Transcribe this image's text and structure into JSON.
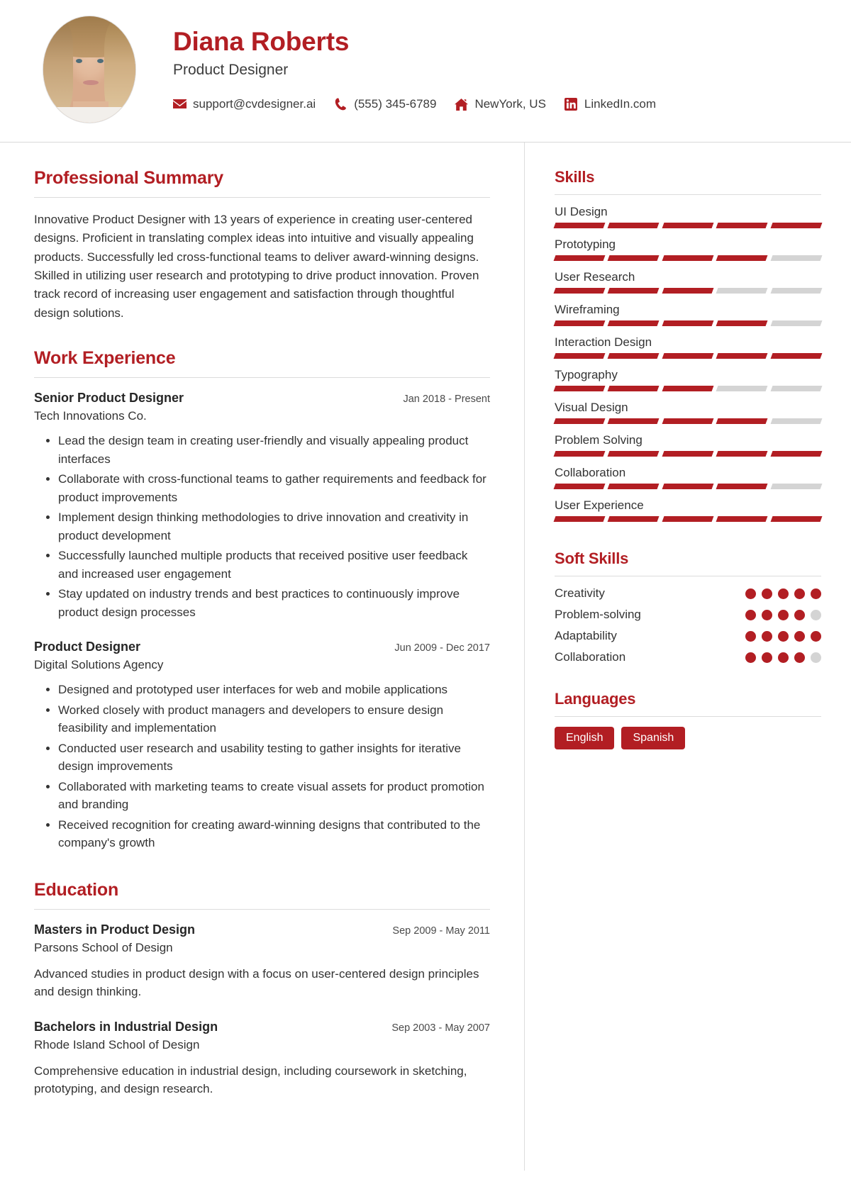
{
  "theme": {
    "accent": "#b21e23",
    "muted": "#d4d4d4",
    "text": "#333333",
    "rule": "#dcdcdc"
  },
  "header": {
    "name": "Diana Roberts",
    "job_title": "Product Designer",
    "avatar_name": "profile-photo",
    "contacts": [
      {
        "icon": "email-icon",
        "value": "support@cvdesigner.ai"
      },
      {
        "icon": "phone-icon",
        "value": "(555) 345-6789"
      },
      {
        "icon": "home-icon",
        "value": "NewYork, US"
      },
      {
        "icon": "linkedin-icon",
        "value": "LinkedIn.com"
      }
    ]
  },
  "main": {
    "summary": {
      "title": "Professional Summary",
      "text": "Innovative Product Designer with 13 years of experience in creating user-centered designs. Proficient in translating complex ideas into intuitive and visually appealing products. Successfully led cross-functional teams to deliver award-winning designs. Skilled in utilizing user research and prototyping to drive product innovation. Proven track record of increasing user engagement and satisfaction through thoughtful design solutions."
    },
    "work": {
      "title": "Work Experience",
      "jobs": [
        {
          "role": "Senior Product Designer",
          "dates": "Jan 2018 - Present",
          "company": "Tech Innovations Co.",
          "bullets": [
            "Lead the design team in creating user-friendly and visually appealing product interfaces",
            "Collaborate with cross-functional teams to gather requirements and feedback for product improvements",
            "Implement design thinking methodologies to drive innovation and creativity in product development",
            "Successfully launched multiple products that received positive user feedback and increased user engagement",
            "Stay updated on industry trends and best practices to continuously improve product design processes"
          ]
        },
        {
          "role": "Product Designer",
          "dates": "Jun 2009 - Dec 2017",
          "company": "Digital Solutions Agency",
          "bullets": [
            "Designed and prototyped user interfaces for web and mobile applications",
            "Worked closely with product managers and developers to ensure design feasibility and implementation",
            "Conducted user research and usability testing to gather insights for iterative design improvements",
            "Collaborated with marketing teams to create visual assets for product promotion and branding",
            "Received recognition for creating award-winning designs that contributed to the company's growth"
          ]
        }
      ]
    },
    "education": {
      "title": "Education",
      "entries": [
        {
          "degree": "Masters in Product Design",
          "dates": "Sep 2009 - May 2011",
          "school": "Parsons School of Design",
          "description": "Advanced studies in product design with a focus on user-centered design principles and design thinking."
        },
        {
          "degree": "Bachelors in Industrial Design",
          "dates": "Sep 2003 - May 2007",
          "school": "Rhode Island School of Design",
          "description": "Comprehensive education in industrial design, including coursework in sketching, prototyping, and design research."
        }
      ]
    }
  },
  "sidebar": {
    "skills": {
      "title": "Skills",
      "max": 5,
      "items": [
        {
          "label": "UI Design",
          "level": 5
        },
        {
          "label": "Prototyping",
          "level": 4
        },
        {
          "label": "User Research",
          "level": 3
        },
        {
          "label": "Wireframing",
          "level": 4
        },
        {
          "label": "Interaction Design",
          "level": 5
        },
        {
          "label": "Typography",
          "level": 3
        },
        {
          "label": "Visual Design",
          "level": 4
        },
        {
          "label": "Problem Solving",
          "level": 5
        },
        {
          "label": "Collaboration",
          "level": 4
        },
        {
          "label": "User Experience",
          "level": 5
        }
      ]
    },
    "soft_skills": {
      "title": "Soft Skills",
      "max": 5,
      "items": [
        {
          "label": "Creativity",
          "level": 5
        },
        {
          "label": "Problem-solving",
          "level": 4
        },
        {
          "label": "Adaptability",
          "level": 5
        },
        {
          "label": "Collaboration",
          "level": 4
        }
      ]
    },
    "languages": {
      "title": "Languages",
      "items": [
        "English",
        "Spanish"
      ]
    }
  }
}
